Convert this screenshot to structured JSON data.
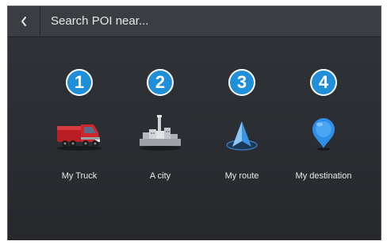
{
  "header": {
    "search_label": "Search POI near..."
  },
  "options": [
    {
      "number": "1",
      "label": "My Truck",
      "icon": "truck-icon"
    },
    {
      "number": "2",
      "label": "A city",
      "icon": "city-icon"
    },
    {
      "number": "3",
      "label": "My route",
      "icon": "route-arrow-icon"
    },
    {
      "number": "4",
      "label": "My destination",
      "icon": "destination-pin-icon"
    }
  ],
  "colors": {
    "badge": "#1e8fd8",
    "background": "#2b2e33",
    "header": "#3a3d42",
    "truck": "#d0252b",
    "pin": "#2f8fe8"
  }
}
